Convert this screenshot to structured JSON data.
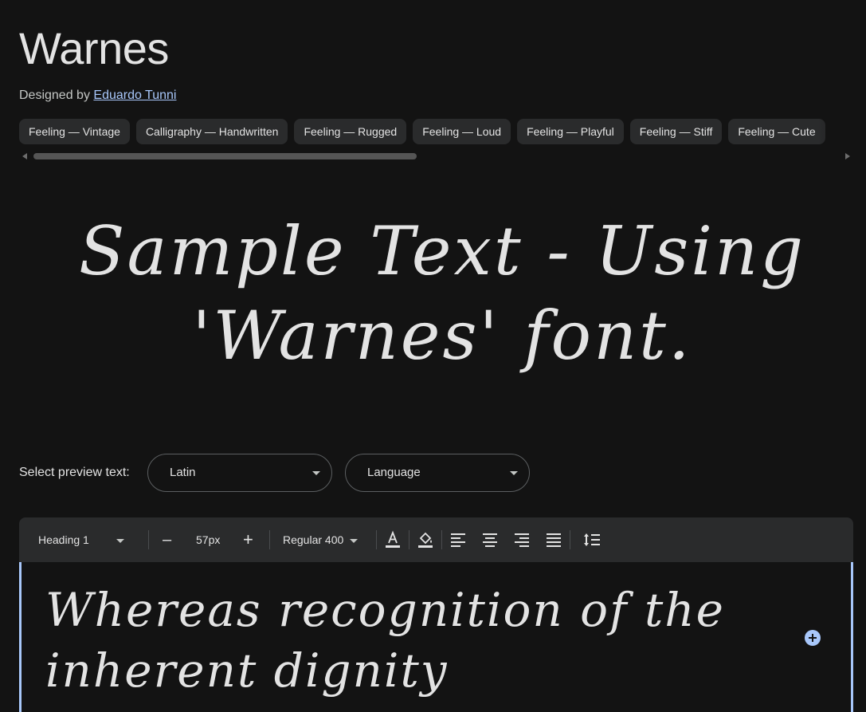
{
  "header": {
    "title": "Warnes",
    "designed_by_prefix": "Designed by",
    "designer_name": "Eduardo Tunni"
  },
  "tags": [
    "Feeling — Vintage",
    "Calligraphy — Handwritten",
    "Feeling — Rugged",
    "Feeling — Loud",
    "Feeling — Playful",
    "Feeling — Stiff",
    "Feeling — Cute"
  ],
  "sample": {
    "text": "Sample Text - Using 'Warnes' font."
  },
  "preview": {
    "label": "Select preview text:",
    "script_value": "Latin",
    "language_value": "Language"
  },
  "toolbar": {
    "style_value": "Heading 1",
    "decrease_label": "–",
    "size_value": "57px",
    "increase_label": "+",
    "weight_value": "Regular 400",
    "text_color_icon": "text-color-icon",
    "highlight_icon": "fill-color-icon",
    "align_left_icon": "align-left-icon",
    "align_center_icon": "align-center-icon",
    "align_right_icon": "align-right-icon",
    "align_justify_icon": "align-justify-icon",
    "line_height_icon": "line-height-icon"
  },
  "editor": {
    "text": "Whereas recognition of the inherent dignity"
  },
  "colors": {
    "background": "#131313",
    "surface": "#2a2b2c",
    "accent": "#a8c7fa",
    "text": "#e3e3e3"
  }
}
